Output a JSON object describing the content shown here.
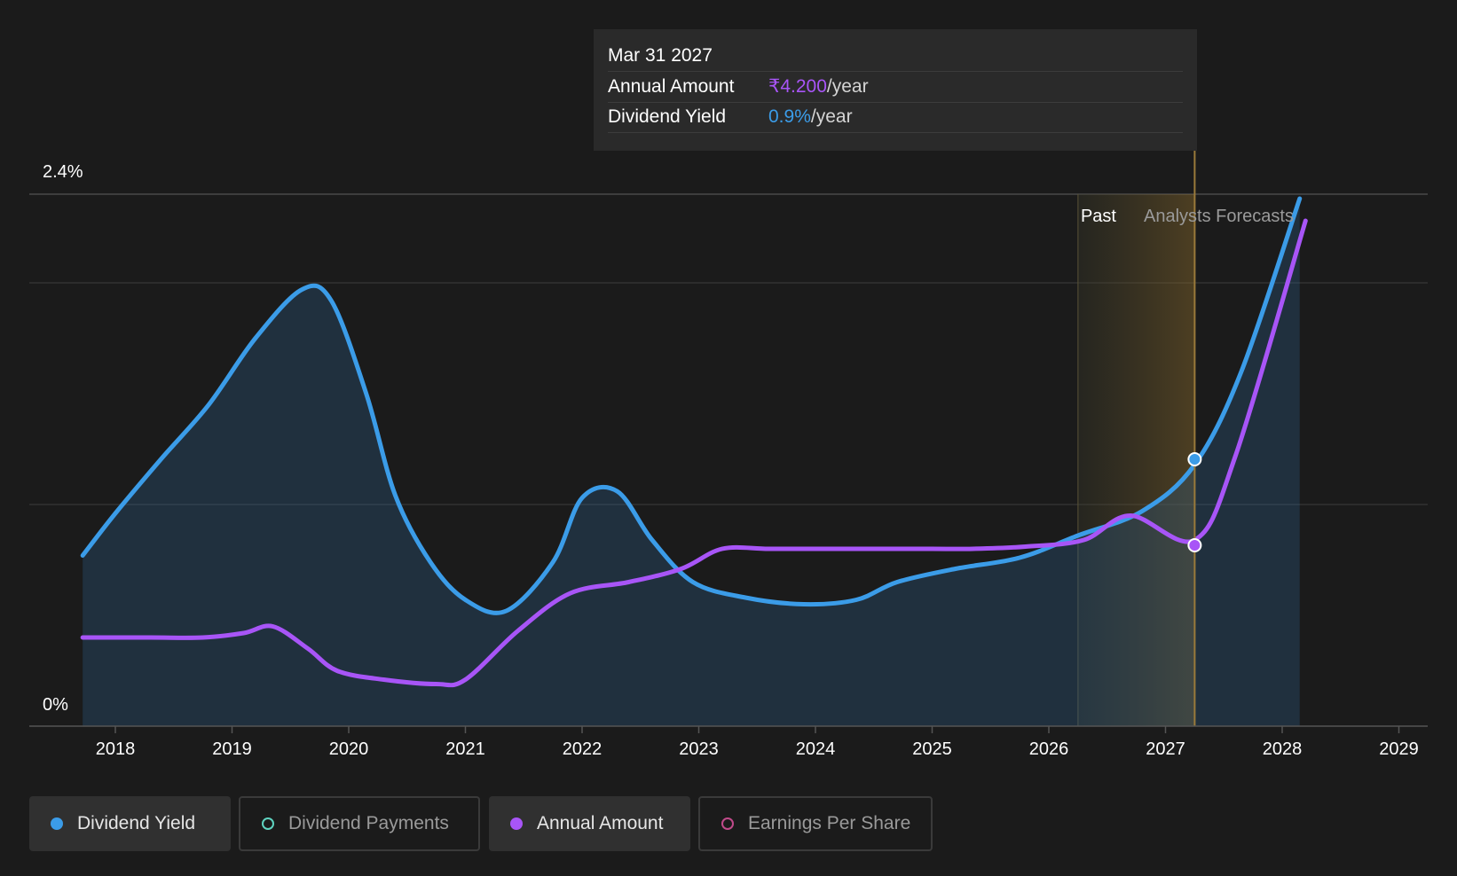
{
  "tooltip": {
    "date": "Mar 31 2027",
    "rows": [
      {
        "label": "Annual Amount",
        "value": "₹4.200",
        "unit": "/year"
      },
      {
        "label": "Dividend Yield",
        "value": "0.9%",
        "unit": "/year"
      }
    ]
  },
  "regions": {
    "past": "Past",
    "forecast": "Analysts Forecasts"
  },
  "legend": [
    {
      "label": "Dividend Yield",
      "color": "#3b9ce8",
      "active": true,
      "filled": true
    },
    {
      "label": "Dividend Payments",
      "color": "#5fd3c0",
      "active": false,
      "filled": false
    },
    {
      "label": "Annual Amount",
      "color": "#a855f7",
      "active": true,
      "filled": true
    },
    {
      "label": "Earnings Per Share",
      "color": "#c04a8a",
      "active": false,
      "filled": false
    }
  ],
  "colors": {
    "yield": "#3b9ce8",
    "amount": "#a855f7",
    "background": "#1b1b1b"
  },
  "chart_data": {
    "type": "line",
    "xlim": [
      2017.63,
      2029.25
    ],
    "ylim": [
      0,
      2.4
    ],
    "y_tick_labels": [
      "2.4%",
      "0%"
    ],
    "x_ticks": [
      2018,
      2019,
      2020,
      2021,
      2022,
      2023,
      2024,
      2025,
      2026,
      2027,
      2028,
      2029
    ],
    "past_forecast_divider": 2026.25,
    "cursor_x": 2027.25,
    "series": [
      {
        "name": "Dividend Yield",
        "unit": "%",
        "points": [
          [
            2017.72,
            0.77
          ],
          [
            2018.0,
            0.96
          ],
          [
            2018.4,
            1.21
          ],
          [
            2018.8,
            1.45
          ],
          [
            2019.2,
            1.75
          ],
          [
            2019.6,
            1.97
          ],
          [
            2019.85,
            1.92
          ],
          [
            2020.15,
            1.5
          ],
          [
            2020.4,
            1.04
          ],
          [
            2020.7,
            0.74
          ],
          [
            2021.0,
            0.57
          ],
          [
            2021.35,
            0.52
          ],
          [
            2021.75,
            0.74
          ],
          [
            2022.0,
            1.03
          ],
          [
            2022.3,
            1.06
          ],
          [
            2022.6,
            0.84
          ],
          [
            2022.95,
            0.65
          ],
          [
            2023.4,
            0.58
          ],
          [
            2023.9,
            0.55
          ],
          [
            2024.35,
            0.57
          ],
          [
            2024.7,
            0.65
          ],
          [
            2025.2,
            0.71
          ],
          [
            2025.75,
            0.76
          ],
          [
            2026.25,
            0.86
          ],
          [
            2026.8,
            0.97
          ],
          [
            2027.25,
            1.18
          ],
          [
            2027.65,
            1.6
          ],
          [
            2028.15,
            2.38
          ]
        ]
      },
      {
        "name": "Annual Amount",
        "unit": "₹",
        "points": [
          [
            2017.72,
            0.4
          ],
          [
            2018.3,
            0.4
          ],
          [
            2018.75,
            0.4
          ],
          [
            2019.1,
            0.42
          ],
          [
            2019.35,
            0.45
          ],
          [
            2019.65,
            0.35
          ],
          [
            2019.9,
            0.25
          ],
          [
            2020.3,
            0.21
          ],
          [
            2020.75,
            0.19
          ],
          [
            2021.0,
            0.21
          ],
          [
            2021.45,
            0.43
          ],
          [
            2021.9,
            0.6
          ],
          [
            2022.4,
            0.65
          ],
          [
            2022.85,
            0.71
          ],
          [
            2023.2,
            0.8
          ],
          [
            2023.6,
            0.8
          ],
          [
            2024.1,
            0.8
          ],
          [
            2024.6,
            0.8
          ],
          [
            2025.0,
            0.8
          ],
          [
            2025.35,
            0.8
          ],
          [
            2025.8,
            0.81
          ],
          [
            2026.3,
            0.84
          ],
          [
            2026.7,
            0.95
          ],
          [
            2027.25,
            0.84
          ],
          [
            2027.6,
            1.22
          ],
          [
            2028.2,
            2.28
          ]
        ]
      }
    ]
  }
}
